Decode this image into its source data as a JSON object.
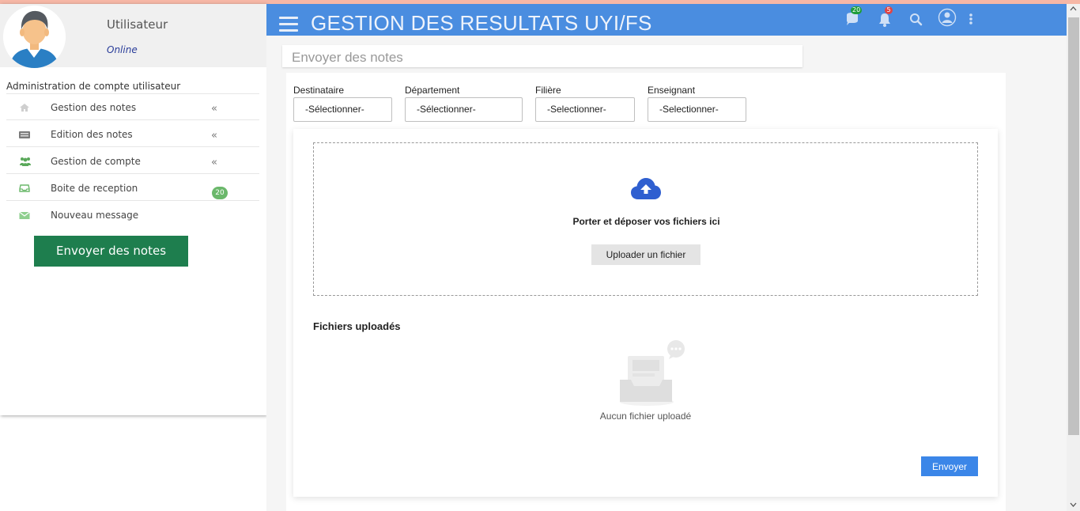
{
  "sidebar": {
    "username": "Utilisateur",
    "status": "Online",
    "menu_header": "Administration de compte utilisateur",
    "items": [
      {
        "label": "Gestion des notes",
        "icon": "home-icon",
        "chevron": "«"
      },
      {
        "label": "Edition des notes",
        "icon": "keyboard-icon",
        "chevron": "«"
      },
      {
        "label": "Gestion de compte",
        "icon": "users-icon",
        "chevron": "«"
      },
      {
        "label": "Boite de reception",
        "icon": "inbox-icon",
        "badge": "20"
      },
      {
        "label": "Nouveau message",
        "icon": "envelope-icon"
      }
    ],
    "action_button": "Envoyer des notes"
  },
  "header": {
    "title": "GESTION DES RESULTATS UYI/FS",
    "messages_count": "20",
    "notifications_count": "5",
    "colors": {
      "bar": "#4a8de0",
      "messages_badge": "#1f9d3a",
      "notifications_badge": "#e04545"
    }
  },
  "page": {
    "title": "Envoyer des notes",
    "filters": [
      {
        "label": "Destinataire",
        "value": "-Sélectionner-"
      },
      {
        "label": "Département",
        "value": "-Sélectionner-"
      },
      {
        "label": "Filière",
        "value": "-Selectionner-"
      },
      {
        "label": "Enseignant",
        "value": "-Selectionner-"
      }
    ],
    "dropzone": {
      "text": "Porter et déposer vos fichiers ici",
      "button": "Uploader un fichier",
      "icon": "cloud-upload-icon"
    },
    "files": {
      "title": "Fichiers uploadés",
      "empty_text": "Aucun fichier uploadé"
    },
    "submit_button": "Envoyer"
  }
}
